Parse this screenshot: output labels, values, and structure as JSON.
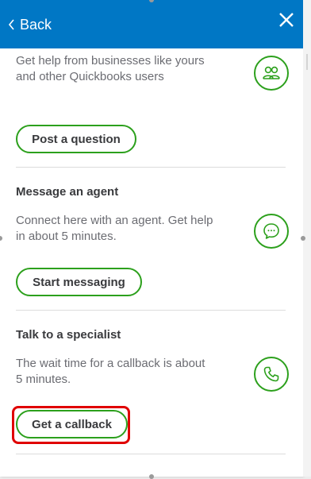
{
  "header": {
    "back_label": "Back",
    "close_icon": "close-icon",
    "back_icon": "chevron-left-icon",
    "background": "#0077c5"
  },
  "sections": [
    {
      "title": "",
      "description": "Get help from businesses like yours and other Quickbooks users",
      "button_label": "Post a question",
      "icon": "community-icon"
    },
    {
      "title": "Message an agent",
      "description": "Connect here with an agent. Get help in about 5 minutes.",
      "button_label": "Start messaging",
      "icon": "chat-bubble-icon"
    },
    {
      "title": "Talk to a specialist",
      "description": "The wait time for a callback is about 5 minutes.",
      "button_label": "Get a callback",
      "icon": "phone-icon"
    }
  ],
  "colors": {
    "accent_green": "#2ca01c",
    "highlight_red": "#e00000",
    "text_dark": "#393a3d",
    "text_muted": "#6b6c72"
  }
}
